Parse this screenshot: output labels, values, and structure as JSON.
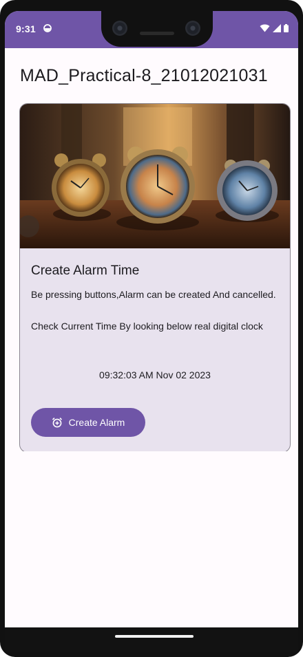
{
  "status_bar": {
    "time": "9:31",
    "background": "#6f55a7"
  },
  "app": {
    "title": "MAD_Practical-8_21012021031"
  },
  "card": {
    "title": "Create Alarm Time",
    "description": "Be pressing buttons,Alarm can be created And cancelled.",
    "instruction": "Check Current Time By looking below real digital clock",
    "clock": "09:32:03 AM Nov 02 2023",
    "button_label": "Create Alarm",
    "button_icon": "alarm-add-icon",
    "button_color": "#6f55a7",
    "card_color": "#e8e2ee"
  }
}
